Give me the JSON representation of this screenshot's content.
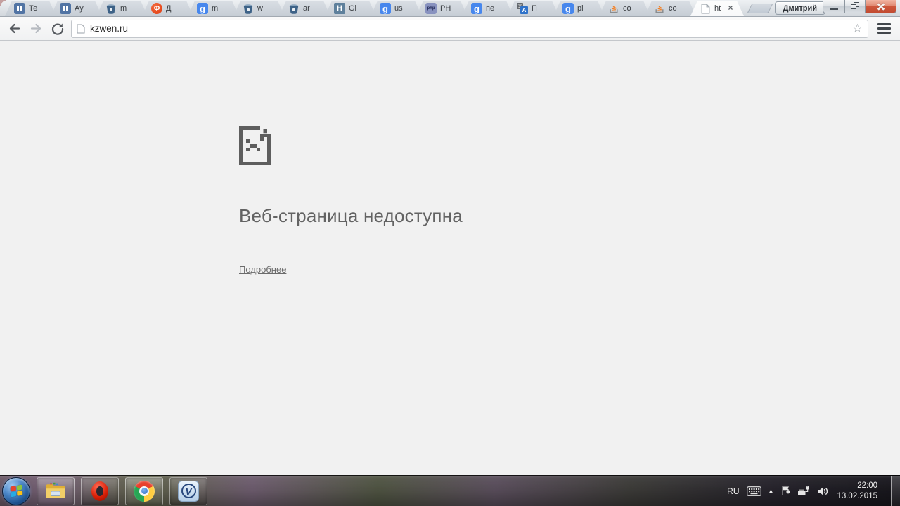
{
  "browser": {
    "profile_button_label": "Дмитрий",
    "window_controls": [
      "minimize-icon",
      "restore-icon",
      "close-icon"
    ],
    "tabs": [
      {
        "icon": "pause-favicon",
        "label": "Те"
      },
      {
        "icon": "pause-favicon",
        "label": "Ау"
      },
      {
        "icon": "bitbucket-favicon",
        "label": "m"
      },
      {
        "icon": "forum-f-favicon",
        "glyph": "Ф",
        "label": "Д"
      },
      {
        "icon": "google-favicon",
        "glyph": "g",
        "label": "m"
      },
      {
        "icon": "bitbucket-favicon",
        "label": "w"
      },
      {
        "icon": "bitbucket-favicon",
        "label": "ar"
      },
      {
        "icon": "habr-favicon",
        "glyph": "H",
        "label": "Gi"
      },
      {
        "icon": "google-favicon",
        "glyph": "g",
        "label": "us"
      },
      {
        "icon": "php-favicon",
        "glyph": "php",
        "label": "PH"
      },
      {
        "icon": "google-favicon",
        "glyph": "g",
        "label": "пе"
      },
      {
        "icon": "translate-favicon",
        "glyph": "A",
        "glyph2": "文",
        "label": "П"
      },
      {
        "icon": "google-favicon",
        "glyph": "g",
        "label": "pl"
      },
      {
        "icon": "stackoverflow-favicon",
        "label": "co"
      },
      {
        "icon": "stackoverflow-favicon",
        "label": "co"
      }
    ],
    "active_tab": {
      "icon": "page-favicon",
      "label": "ht",
      "close_glyph": "×"
    },
    "toolbar": {
      "url": "kzwen.ru",
      "bookmark_star_glyph": "☆"
    }
  },
  "error_page": {
    "icon": "sad-file-icon",
    "title": "Веб-страница недоступна",
    "details_link": "Подробнее"
  },
  "taskbar": {
    "start_button": "start-orb-icon",
    "apps": [
      "explorer-icon",
      "opera-icon",
      "chrome-icon",
      "v-app-icon"
    ],
    "tray": {
      "language": "RU",
      "hidden_icons_glyph": "▲",
      "time": "22:00",
      "date": "13.02.2015"
    }
  },
  "colors": {
    "close_button_red": "#c24b31",
    "google_blue": "#4787ed",
    "php_purple": "#8892bf",
    "stackoverflow_orange": "#f48024",
    "opera_red": "#d92108",
    "error_text_gray": "#636363",
    "frame_silver": "#d2d7dd",
    "page_bg": "#f1f1f1"
  }
}
